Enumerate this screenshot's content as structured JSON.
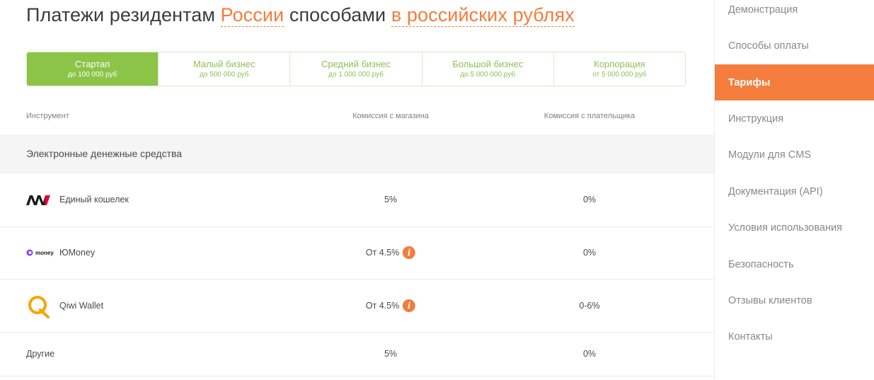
{
  "title": {
    "part1": "Платежи резидентам ",
    "highlight1": "России",
    "part2": " способами ",
    "highlight2": "в российских рублях"
  },
  "plans": [
    {
      "name": "Стартап",
      "range": "до 100 000 руб",
      "active": true
    },
    {
      "name": "Малый бизнес",
      "range": "до 500 000 руб",
      "active": false
    },
    {
      "name": "Средний бизнес",
      "range": "до 1 000 000 руб",
      "active": false
    },
    {
      "name": "Большой бизнес",
      "range": "до 5 000 000 руб",
      "active": false
    },
    {
      "name": "Корпорация",
      "range": "от 5 000 000 руб",
      "active": false
    }
  ],
  "table": {
    "headers": {
      "instrument": "Инструмент",
      "shop_fee": "Комиссия с магазина",
      "payer_fee": "Комиссия с плательщика"
    },
    "group_title": "Электронные денежные средства",
    "rows": [
      {
        "name": "Единый кошелек",
        "shop_fee": "5%",
        "payer_fee": "0%",
        "icon": "w1-wallet-logo",
        "info": false
      },
      {
        "name": "ЮMoney",
        "shop_fee": "От 4.5%",
        "payer_fee": "0%",
        "icon": "yoomoney-logo",
        "info": true
      },
      {
        "name": "Qiwi Wallet",
        "shop_fee": "От 4.5%",
        "payer_fee": "0-6%",
        "icon": "qiwi-logo",
        "info": true
      },
      {
        "name": "Другие",
        "shop_fee": "5%",
        "payer_fee": "0%",
        "icon": "",
        "info": false
      }
    ],
    "info_glyph": "i",
    "yoomoney_logo_text": "money"
  },
  "sidebar": {
    "items": [
      {
        "label": "Демонстрация",
        "active": false
      },
      {
        "label": "Способы оплаты",
        "active": false
      },
      {
        "label": "Тарифы",
        "active": true
      },
      {
        "label": "Инструкция",
        "active": false
      },
      {
        "label": "Модули для CMS",
        "active": false
      },
      {
        "label": "Документация (API)",
        "active": false
      },
      {
        "label": "Условия использования",
        "active": false
      },
      {
        "label": "Безопасность",
        "active": false
      },
      {
        "label": "Отзывы клиентов",
        "active": false
      },
      {
        "label": "Контакты",
        "active": false
      }
    ]
  },
  "colors": {
    "accent_orange": "#f47c3c",
    "accent_green": "#8cc447"
  }
}
